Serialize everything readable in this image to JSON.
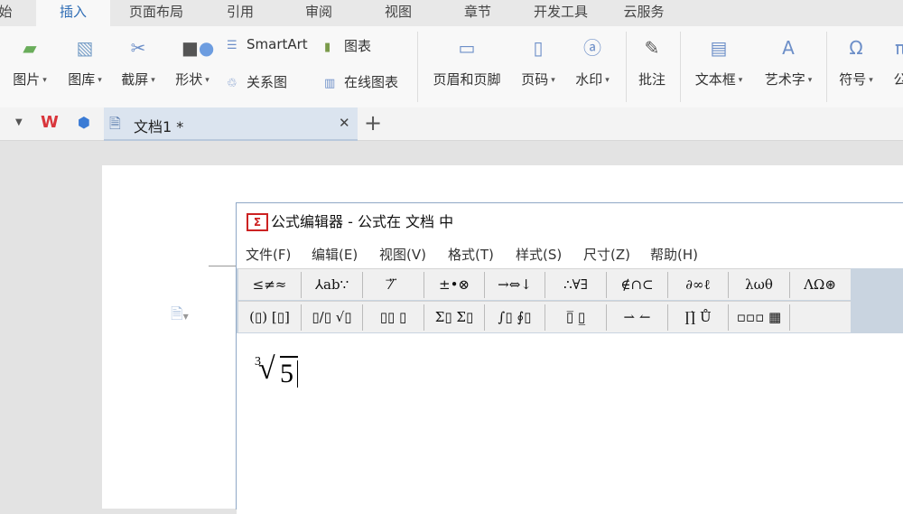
{
  "ribbon_tabs": [
    "始",
    "插入",
    "页面布局",
    "引用",
    "审阅",
    "视图",
    "章节",
    "开发工具",
    "云服务"
  ],
  "active_tab": "插入",
  "ribbon": {
    "picture": "图片",
    "gallery": "图库",
    "screenshot": "截屏",
    "shapes": "形状",
    "smartart": "SmartArt",
    "chart": "图表",
    "relation": "关系图",
    "online_chart": "在线图表",
    "header_footer": "页眉和页脚",
    "page_number": "页码",
    "watermark": "水印",
    "comment": "批注",
    "textbox": "文本框",
    "wordart": "艺术字",
    "symbol": "符号",
    "formula": "公"
  },
  "doc_tab": {
    "title": "文档1 *"
  },
  "equation_editor": {
    "title": "公式编辑器 - 公式在 文档 中",
    "menu": [
      "文件(F)",
      "编辑(E)",
      "视图(V)",
      "格式(T)",
      "样式(S)",
      "尺寸(Z)",
      "帮助(H)"
    ],
    "palette_row1": [
      "≤≠≈",
      "⅄ab∵",
      "⁄⃗ ⃛",
      "±•⊗",
      "→⇔↓",
      "∴∀∃",
      "∉∩⊂",
      "∂∞ℓ",
      "λωθ",
      "ΛΩ⊛"
    ],
    "palette_row2": [
      "(▯) [▯]",
      "▯/▯ √▯",
      "▯▯ ▯",
      "Σ▯ Σ▯",
      "∫▯ ∮▯",
      "▯̅ ▯̲",
      "⇀ ↼",
      "∏̇ Ů",
      "▫▫▫ ▦"
    ],
    "formula": {
      "index": "3",
      "radicand": "5"
    }
  }
}
